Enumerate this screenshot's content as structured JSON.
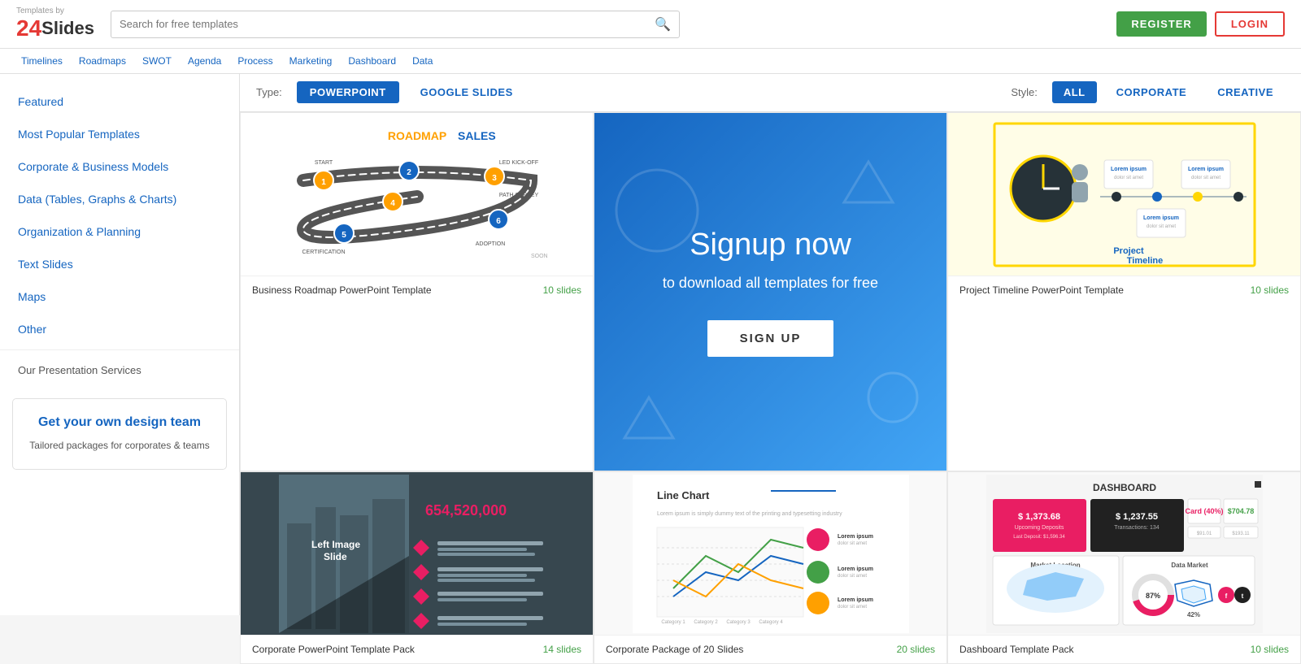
{
  "logo": {
    "by_text": "Templates by",
    "number": "24",
    "name": "Slides"
  },
  "search": {
    "placeholder": "Search for free templates"
  },
  "header_buttons": {
    "register": "REGISTER",
    "login": "LOGIN"
  },
  "filter_tags": [
    "Timelines",
    "Roadmaps",
    "SWOT",
    "Agenda",
    "Process",
    "Marketing",
    "Dashboard",
    "Data"
  ],
  "type_bar": {
    "label": "Type:",
    "options": [
      "POWERPOINT",
      "GOOGLE SLIDES"
    ],
    "active": "POWERPOINT"
  },
  "style_bar": {
    "label": "Style:",
    "options": [
      "ALL",
      "CORPORATE",
      "CREATIVE"
    ],
    "active": "ALL"
  },
  "sidebar": {
    "items": [
      {
        "id": "featured",
        "label": "Featured",
        "active": false
      },
      {
        "id": "most-popular",
        "label": "Most Popular Templates",
        "active": false
      },
      {
        "id": "corporate-business",
        "label": "Corporate & Business Models",
        "active": false
      },
      {
        "id": "data-tables",
        "label": "Data (Tables, Graphs & Charts)",
        "active": false
      },
      {
        "id": "organization-planning",
        "label": "Organization & Planning",
        "active": false
      },
      {
        "id": "text-slides",
        "label": "Text Slides",
        "active": false
      },
      {
        "id": "maps",
        "label": "Maps",
        "active": false
      },
      {
        "id": "other",
        "label": "Other",
        "active": false
      }
    ],
    "services_label": "Our Presentation Services",
    "promo": {
      "title": "Get your own design team",
      "body": "Tailored packages for corporates & teams"
    }
  },
  "templates": [
    {
      "id": "roadmap",
      "title": "Business Roadmap PowerPoint Template",
      "slides": "10 slides",
      "type": "roadmap"
    },
    {
      "id": "signup",
      "type": "signup"
    },
    {
      "id": "timeline",
      "title": "Project Timeline PowerPoint Template",
      "slides": "10 slides",
      "type": "timeline"
    },
    {
      "id": "corporate-pack",
      "title": "Corporate PowerPoint Template Pack",
      "slides": "14 slides",
      "type": "corporate"
    },
    {
      "id": "line-chart",
      "title": "Corporate Package of 20 Slides",
      "slides": "20 slides",
      "type": "linechart"
    },
    {
      "id": "dashboard",
      "title": "Dashboard Template Pack",
      "slides": "10 slides",
      "type": "dashboard"
    }
  ],
  "signup_card": {
    "heading": "Signup now",
    "subtext": "to download all templates for free",
    "button": "SIGN UP"
  }
}
